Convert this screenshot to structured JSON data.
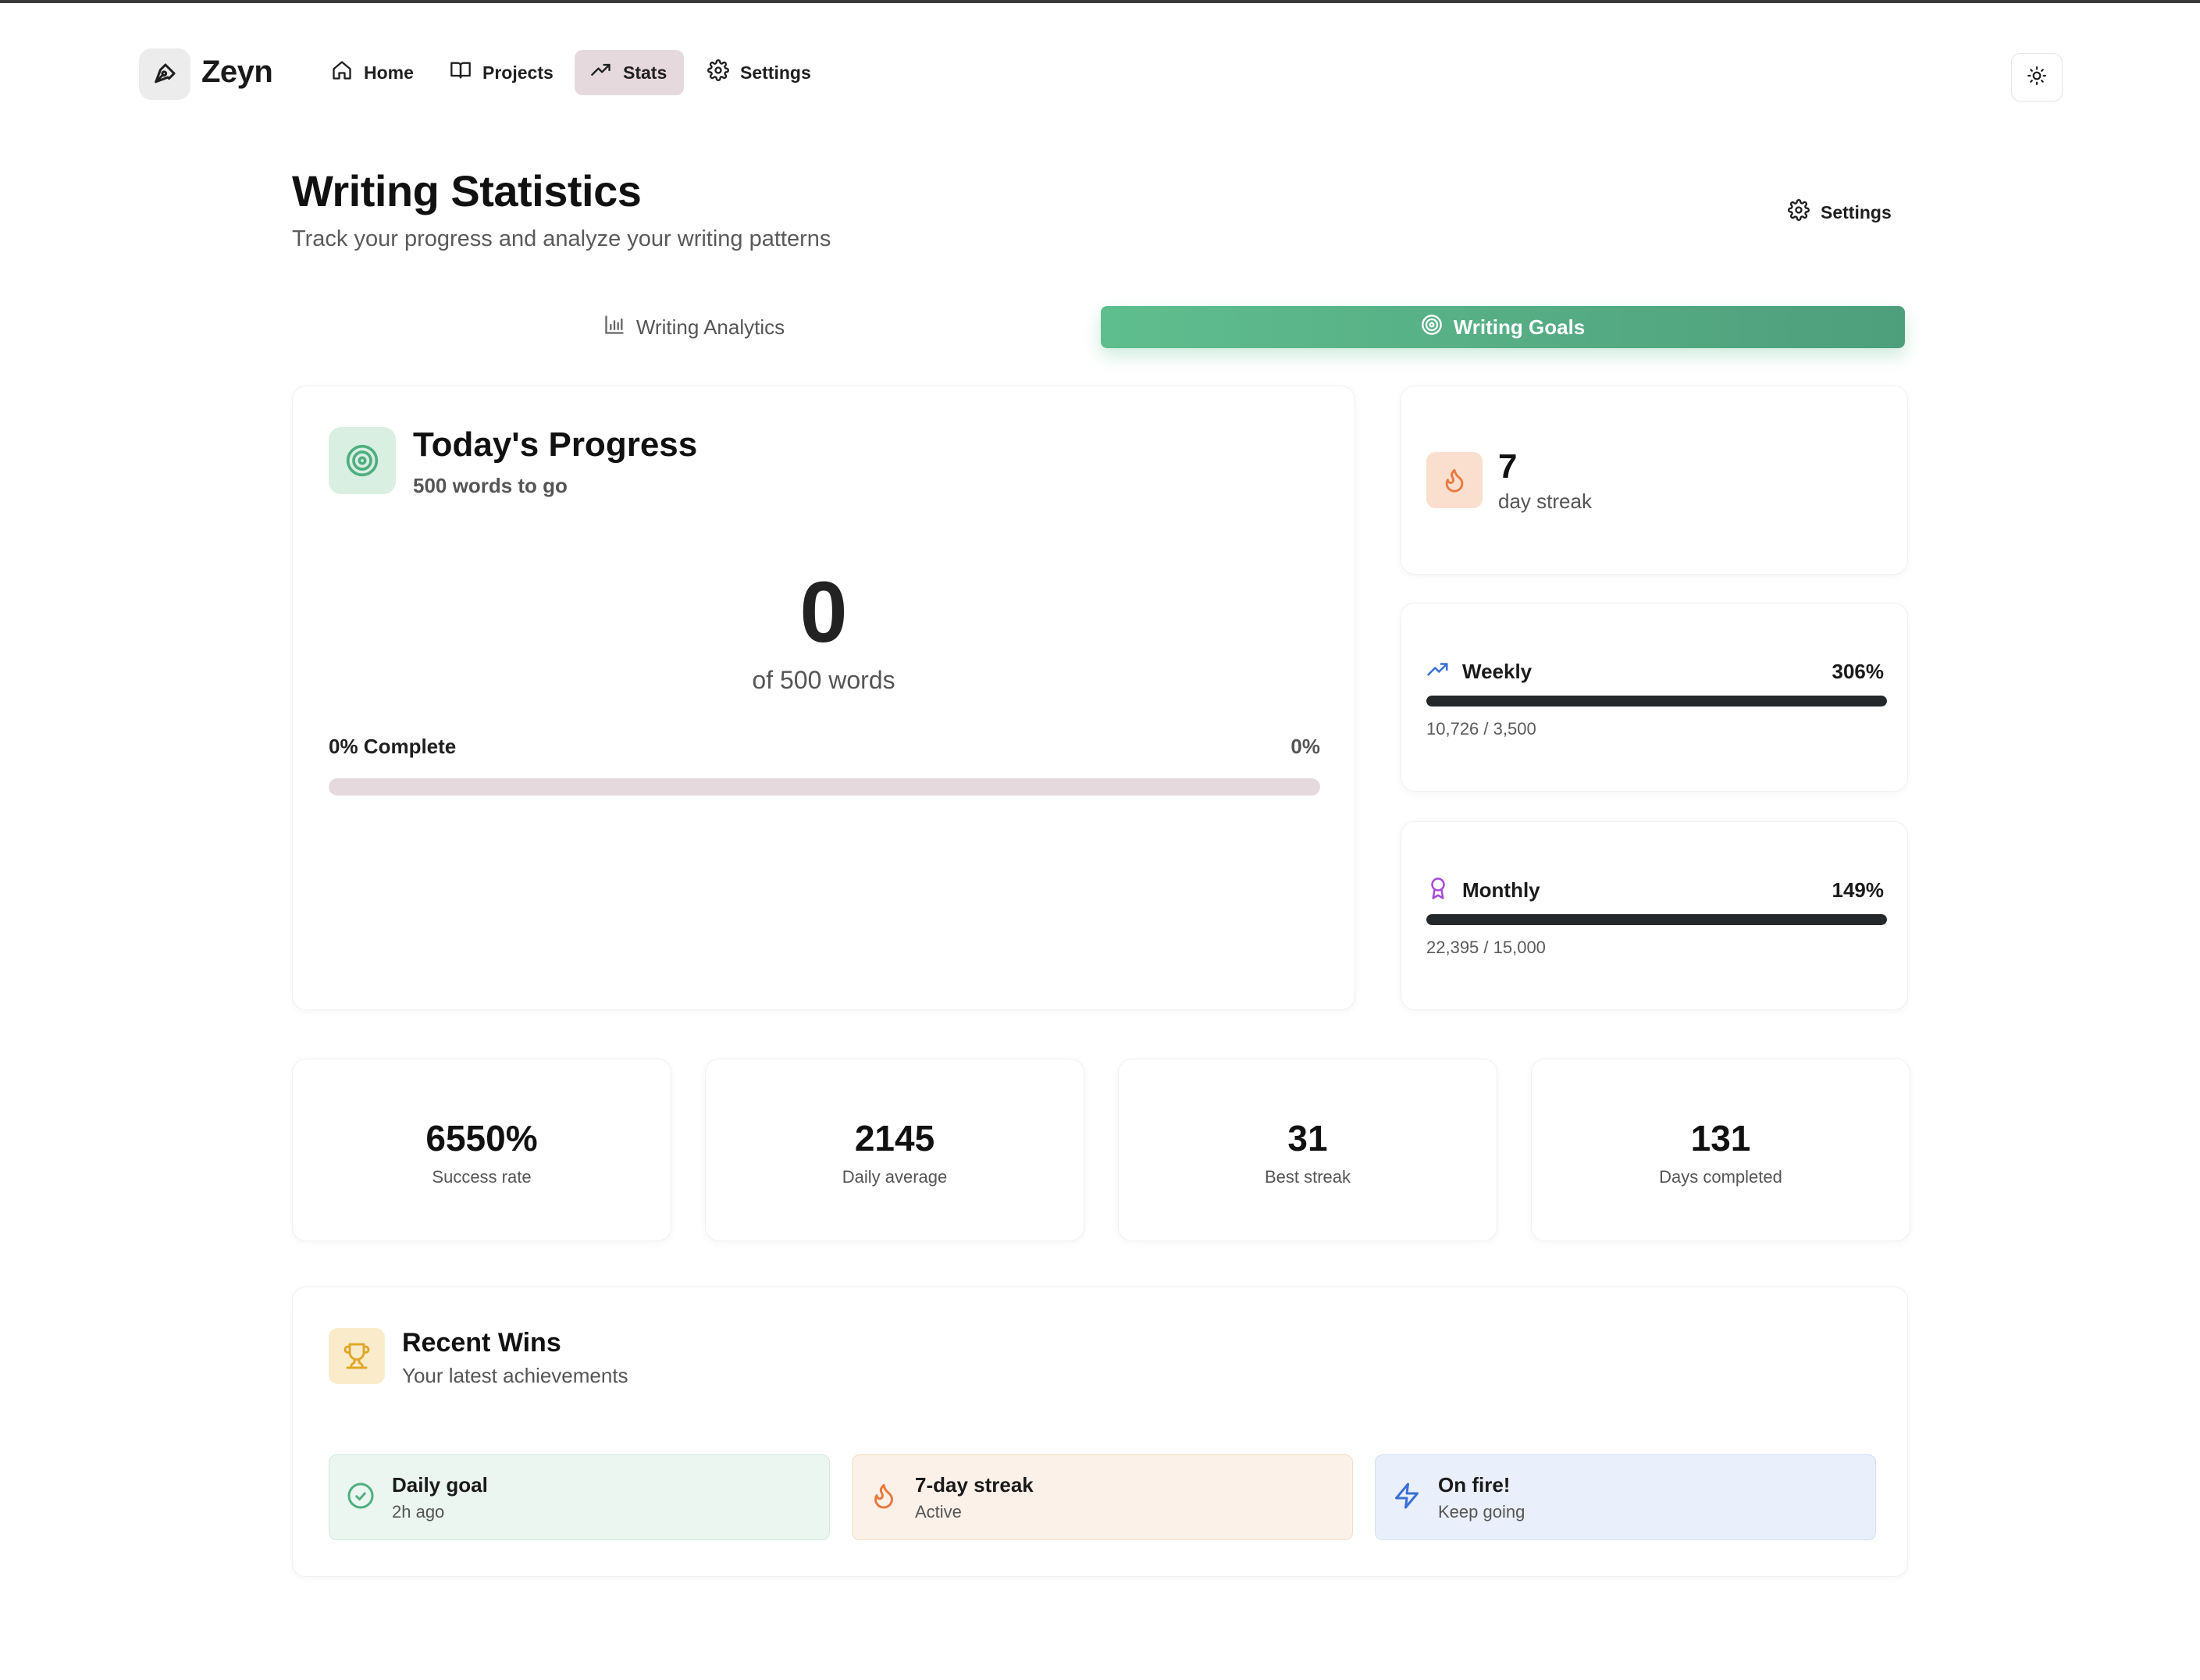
{
  "app": {
    "name": "Zeyn"
  },
  "nav": {
    "items": [
      {
        "label": "Home",
        "icon": "home-icon"
      },
      {
        "label": "Projects",
        "icon": "book-icon"
      },
      {
        "label": "Stats",
        "icon": "trending-up-icon",
        "active": true
      },
      {
        "label": "Settings",
        "icon": "gear-icon"
      }
    ],
    "theme_toggle_icon": "sun-icon"
  },
  "header": {
    "title": "Writing Statistics",
    "subtitle": "Track your progress and analyze your writing patterns",
    "settings_label": "Settings"
  },
  "tabs": [
    {
      "label": "Writing Analytics",
      "icon": "bar-chart-icon",
      "active": false
    },
    {
      "label": "Writing Goals",
      "icon": "target-icon",
      "active": true
    }
  ],
  "today": {
    "title": "Today's Progress",
    "subtitle": "500 words to go",
    "count": "0",
    "of_label": "of 500 words",
    "complete_label": "0% Complete",
    "percent_label": "0%",
    "progress_fraction": 0.0
  },
  "streak": {
    "value": "7",
    "label": "day streak"
  },
  "goals": {
    "weekly": {
      "name": "Weekly",
      "percent": "306%",
      "detail": "10,726 / 3,500",
      "progress_fraction": 1.0
    },
    "monthly": {
      "name": "Monthly",
      "percent": "149%",
      "detail": "22,395 / 15,000",
      "progress_fraction": 1.0
    }
  },
  "stats": [
    {
      "value": "6550%",
      "label": "Success rate"
    },
    {
      "value": "2145",
      "label": "Daily average"
    },
    {
      "value": "31",
      "label": "Best streak"
    },
    {
      "value": "131",
      "label": "Days completed"
    }
  ],
  "wins": {
    "title": "Recent Wins",
    "subtitle": "Your latest achievements",
    "items": [
      {
        "title": "Daily goal",
        "sub": "2h ago",
        "icon": "check-circle-icon"
      },
      {
        "title": "7-day streak",
        "sub": "Active",
        "icon": "flame-icon"
      },
      {
        "title": "On fire!",
        "sub": "Keep going",
        "icon": "zap-icon"
      }
    ]
  },
  "colors": {
    "accent_green": "#5fbe8e",
    "active_nav_bg": "#e6d9dd",
    "bar_dark": "#25282b",
    "flame_orange": "#e8793a",
    "trophy_amber": "#e0a828",
    "weekly_blue": "#3b6fd6",
    "monthly_purple": "#a54bd6"
  }
}
